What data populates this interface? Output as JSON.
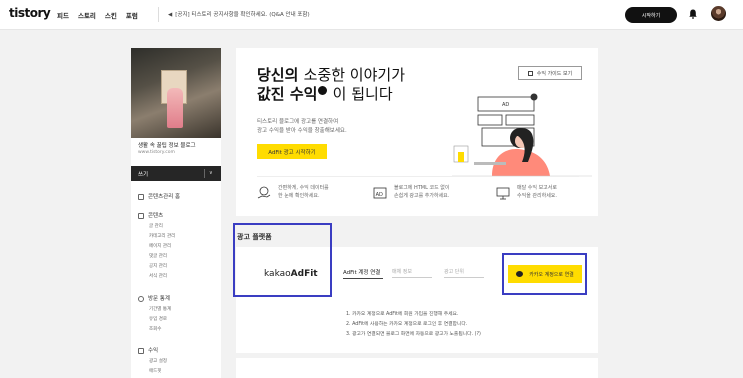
{
  "topbar": {
    "logo": "tistory",
    "nav_items": [
      "피드",
      "스토리",
      "스킨",
      "포럼"
    ],
    "notice": "[공지] 티스토리 공지사항을 확인하세요. (Q&A 안내 포함)",
    "start_button": "시작하기"
  },
  "sidebar": {
    "blog_name": "생활 속 꿀팁 정보 블로그",
    "blog_url": "www.tistory.com",
    "dark_label": "쓰기",
    "menu": [
      {
        "label": "콘텐츠관리 홈",
        "sub": []
      },
      {
        "label": "콘텐츠",
        "sub": [
          "글 관리",
          "카테고리 관리",
          "페이지 관리",
          "댓글 관리",
          "공지 관리",
          "서식 관리"
        ]
      },
      {
        "label": "방문 통계",
        "sub": [
          "기간별 통계",
          "유입 경로",
          "조회수"
        ]
      },
      {
        "label": "수익",
        "sub": [
          "광고 설정",
          "애드핏"
        ]
      }
    ]
  },
  "hero": {
    "title_line1_bold": "당신의",
    "title_line1_rest": "소중한 이야기가",
    "title_line2_bold": "값진 수익",
    "title_line2_rest": "이 됩니다",
    "desc_line1": "티스토리 블로그에 광고를 연결하여",
    "desc_line2": "광고 수익을 받아 수익을 창출해보세요.",
    "cta": "AdFit 광고 시작하기",
    "guide_button": "수익 가이드 보기",
    "features": [
      {
        "line1": "간편하게, 수익 데이터를",
        "line2": "한 눈에 확인하세요."
      },
      {
        "line1": "블로그에 HTML 코드 없이",
        "line2": "손쉽게 광고를 추가하세요."
      },
      {
        "line1": "매달 수익 보고서로",
        "line2": "수익을 관리하세요."
      }
    ]
  },
  "adfit_section": {
    "title": "광고 플랫폼",
    "logo_text_light": "kakao",
    "logo_text_bold": "AdFit",
    "account_label": "AdFit 계정 연결",
    "field1": "매체 정보",
    "field2": "광고 단위",
    "kakao_button": "카카오 계정으로 연결",
    "steps": [
      "1.  카카오 계정으로 AdFit에 회원 가입을 진행해 주세요.",
      "2.  AdFit에 사용하는 카카오 계정으로 로그인 후 연결합니다.",
      "3.  광고가 연결되면 블로그 화면에 자동으로 광고가 노출됩니다. (?)"
    ]
  },
  "colors": {
    "accent_yellow": "#ffdc00",
    "highlight_box": "#3a3dc2",
    "dark": "#262626"
  }
}
